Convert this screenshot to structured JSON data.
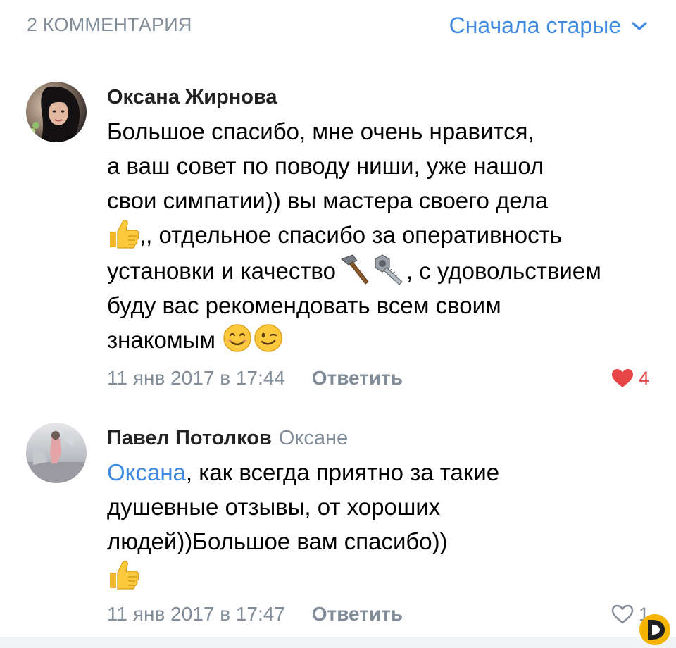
{
  "header": {
    "count_label": "2 КОММЕНТАРИЯ",
    "sort_label": "Сначала старые"
  },
  "colors": {
    "accent": "#3f8ae0",
    "secondary": "#818c99",
    "like_active": "#e64646"
  },
  "comments": [
    {
      "author": "Оксана Жирнова",
      "reply_to": "",
      "mention": "",
      "text_lines": [
        "Большое спасибо, мне очень нравится,",
        "а ваш совет по поводу ниши, уже нашол",
        "свои симпатии)) вы мастера своего дела",
        ",, отдельное спасибо за оперативность",
        "установки и качество",
        ", с удовольствием",
        "буду вас рекомендовать всем своим",
        "знакомым"
      ],
      "emojis": [
        "thumbs-up",
        "hammer",
        "nut-and-bolt",
        "smiling-face",
        "winking-face"
      ],
      "timestamp": "11 янв 2017 в 17:44",
      "reply_label": "Ответить",
      "likes": "4",
      "liked": true
    },
    {
      "author": "Павел Потолков",
      "reply_to": "Оксане",
      "mention": "Оксана",
      "text_lines": [
        ", как всегда приятно за такие",
        "душевные отзывы, от хороших",
        "людей))Большое вам спасибо))"
      ],
      "emojis": [
        "thumbs-up"
      ],
      "timestamp": "11 янв 2017 в 17:47",
      "reply_label": "Ответить",
      "likes": "1",
      "liked": false
    }
  ]
}
